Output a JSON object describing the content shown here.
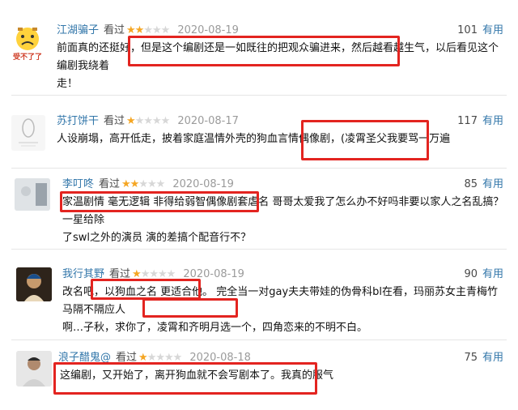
{
  "reviews": [
    {
      "user": "江湖骗子",
      "watched": "看过",
      "stars": 2,
      "date": "2020-08-19",
      "votes": "101",
      "useful": "有用",
      "avatar_text": "受不了了",
      "line1": "前面真的还挺好，但是这个编剧还是一如既往的把观众骗进来，然后越看越生气，以后看见这个编剧我绕着",
      "line2": "走！"
    },
    {
      "user": "苏打饼干",
      "watched": "看过",
      "stars": 1,
      "date": "2020-08-17",
      "votes": "117",
      "useful": "有用",
      "line1": "人设崩塌，高开低走，披着家庭温情外壳的狗血言情偶像剧，(凌霄圣父我要骂一万遍",
      "line2": ""
    },
    {
      "user": "李叮咚",
      "watched": "看过",
      "stars": 2,
      "date": "2020-08-19",
      "votes": "85",
      "useful": "有用",
      "line1": "家温剧情 毫无逻辑 非得给弱智偶像剧套虐名 哥哥太爱我了怎么办不好吗非要以家人之名乱搞？ 一星给除",
      "line2": "了swl之外的演员 演的差搞个配音行不？"
    },
    {
      "user": "我行其野",
      "watched": "看过",
      "stars": 1,
      "date": "2020-08-19",
      "votes": "90",
      "useful": "有用",
      "line1": "改名吧，以狗血之名 更适合他。 完全当一对gay夫夫带娃的伪骨科bl在看，玛丽苏女主青梅竹马隔不隔应人",
      "line2": "啊…子秋，求你了，凌霄和齐明月选一个，四角恋来的不明不白。"
    },
    {
      "user": "浪子醋鬼@",
      "watched": "看过",
      "stars": 1,
      "date": "2020-08-18",
      "votes": "75",
      "useful": "有用",
      "line1": "这编剧，又开始了，离开狗血就不会写剧本了。我真的服气",
      "line2": ""
    }
  ],
  "colors": {
    "highlight": "#e32420",
    "link": "#3377aa",
    "star": "#f5a623"
  }
}
